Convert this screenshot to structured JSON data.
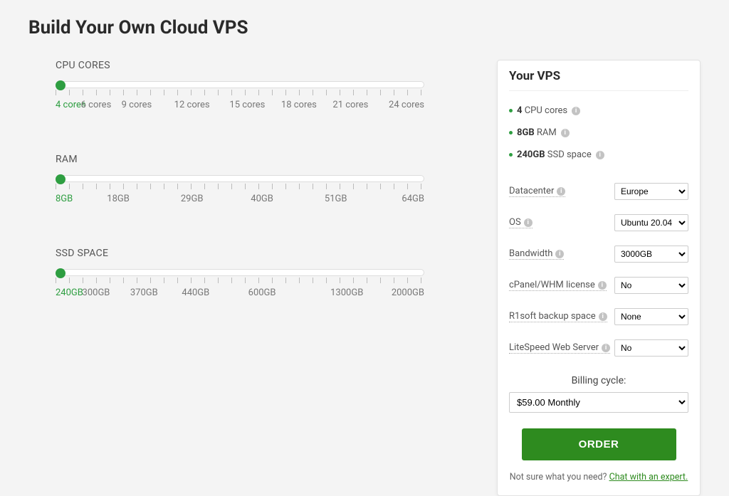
{
  "title": "Build Your Own Cloud VPS",
  "sliders": {
    "cpu": {
      "label": "CPU CORES",
      "ticks": [
        "4 cores",
        "6 cores",
        "9 cores",
        "12 cores",
        "15 cores",
        "18 cores",
        "21 cores",
        "24 cores"
      ],
      "selectedIndex": 0,
      "positions": [
        0,
        11,
        22,
        37,
        52,
        66,
        80,
        100
      ]
    },
    "ram": {
      "label": "RAM",
      "ticks": [
        "8GB",
        "18GB",
        "29GB",
        "40GB",
        "51GB",
        "64GB"
      ],
      "selectedIndex": 0,
      "positions": [
        0,
        17,
        37,
        56,
        76,
        100
      ]
    },
    "ssd": {
      "label": "SSD SPACE",
      "ticks": [
        "240GB",
        "300GB",
        "370GB",
        "440GB",
        "600GB",
        "1300GB",
        "2000GB"
      ],
      "selectedIndex": 0,
      "positions": [
        0,
        11,
        24,
        38,
        56,
        79,
        100
      ]
    }
  },
  "panel": {
    "title": "Your VPS",
    "specs": [
      {
        "value": "4",
        "unit": "CPU cores"
      },
      {
        "value": "8GB",
        "unit": "RAM"
      },
      {
        "value": "240GB",
        "unit": "SSD space"
      }
    ],
    "options": [
      {
        "label": "Datacenter",
        "value": "Europe"
      },
      {
        "label": "OS",
        "value": "Ubuntu 20.04"
      },
      {
        "label": "Bandwidth",
        "value": "3000GB"
      },
      {
        "label": "cPanel/WHM license",
        "value": "No"
      },
      {
        "label": "R1soft backup space",
        "value": "None"
      },
      {
        "label": "LiteSpeed Web Server",
        "value": "No"
      }
    ],
    "billing_label": "Billing cycle:",
    "billing_value": "$59.00 Monthly",
    "order_label": "ORDER",
    "help_text": "Not sure what you need?",
    "help_link": "Chat with an expert."
  }
}
